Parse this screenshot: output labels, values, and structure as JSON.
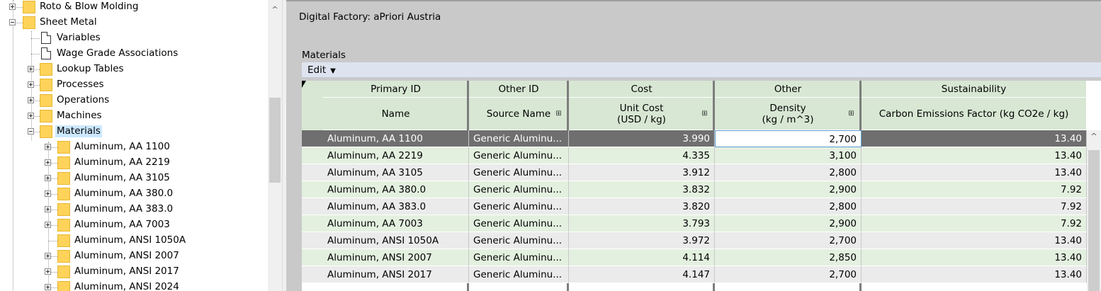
{
  "tree": {
    "nodes": [
      {
        "label": "Roto & Blow Molding",
        "level": 1,
        "kind": "folder",
        "expander": "plus"
      },
      {
        "label": "Sheet Metal",
        "level": 1,
        "kind": "folder",
        "expander": "minus"
      },
      {
        "label": "Variables",
        "level": 2,
        "kind": "doc",
        "expander": "none"
      },
      {
        "label": "Wage Grade Associations",
        "level": 2,
        "kind": "doc",
        "expander": "none"
      },
      {
        "label": "Lookup Tables",
        "level": 2,
        "kind": "folder",
        "expander": "plus"
      },
      {
        "label": "Processes",
        "level": 2,
        "kind": "folder",
        "expander": "plus"
      },
      {
        "label": "Operations",
        "level": 2,
        "kind": "folder",
        "expander": "plus"
      },
      {
        "label": "Machines",
        "level": 2,
        "kind": "folder",
        "expander": "plus"
      },
      {
        "label": "Materials",
        "level": 2,
        "kind": "folder",
        "expander": "minus",
        "selected": true
      },
      {
        "label": "Aluminum, AA 1100",
        "level": 3,
        "kind": "folder",
        "expander": "plus"
      },
      {
        "label": "Aluminum, AA 2219",
        "level": 3,
        "kind": "folder",
        "expander": "plus"
      },
      {
        "label": "Aluminum, AA 3105",
        "level": 3,
        "kind": "folder",
        "expander": "plus"
      },
      {
        "label": "Aluminum, AA 380.0",
        "level": 3,
        "kind": "folder",
        "expander": "plus"
      },
      {
        "label": "Aluminum, AA 383.0",
        "level": 3,
        "kind": "folder",
        "expander": "plus"
      },
      {
        "label": "Aluminum, AA 7003",
        "level": 3,
        "kind": "folder",
        "expander": "plus"
      },
      {
        "label": "Aluminum, ANSI 1050A",
        "level": 3,
        "kind": "folder",
        "expander": "none"
      },
      {
        "label": "Aluminum, ANSI 2007",
        "level": 3,
        "kind": "folder",
        "expander": "plus"
      },
      {
        "label": "Aluminum, ANSI 2017",
        "level": 3,
        "kind": "folder",
        "expander": "plus"
      },
      {
        "label": "Aluminum, ANSI 2024",
        "level": 3,
        "kind": "folder",
        "expander": "plus"
      }
    ],
    "scroll_up_glyph": "^"
  },
  "main": {
    "digital_factory": "Digital Factory:  aPriori Austria",
    "materials_label": "Materials",
    "edit_label": "Edit",
    "edit_caret": "▼"
  },
  "grid": {
    "groups": [
      {
        "label": "Primary ID",
        "key": "name"
      },
      {
        "label": "Other ID",
        "key": "source"
      },
      {
        "label": "Cost",
        "key": "cost"
      },
      {
        "label": "Other",
        "key": "density"
      },
      {
        "label": "Sustainability",
        "key": "carbon"
      }
    ],
    "columns": [
      {
        "key": "name",
        "label": "Name",
        "filter": false,
        "align": "left"
      },
      {
        "key": "source",
        "label": "Source Name",
        "filter": true,
        "align": "left"
      },
      {
        "key": "cost",
        "label": "Unit Cost\n(USD / kg)",
        "filter": true,
        "align": "right"
      },
      {
        "key": "density",
        "label": "Density\n(kg / m^3)",
        "filter": true,
        "align": "right"
      },
      {
        "key": "carbon",
        "label": "Carbon Emissions Factor (kg CO2e / kg)",
        "filter": false,
        "align": "right"
      }
    ],
    "filter_glyph": "⊞",
    "rows": [
      {
        "name": "Aluminum, AA 1100",
        "source": "Generic Aluminu...",
        "cost": "3.990",
        "density": "2,700",
        "carbon": "13.40",
        "selected": true
      },
      {
        "name": "Aluminum, AA 2219",
        "source": "Generic Aluminu...",
        "cost": "4.335",
        "density": "3,100",
        "carbon": "13.40"
      },
      {
        "name": "Aluminum, AA 3105",
        "source": "Generic Aluminu...",
        "cost": "3.912",
        "density": "2,800",
        "carbon": "13.40"
      },
      {
        "name": "Aluminum, AA 380.0",
        "source": "Generic Aluminu...",
        "cost": "3.832",
        "density": "2,900",
        "carbon": "7.92"
      },
      {
        "name": "Aluminum, AA 383.0",
        "source": "Generic Aluminu...",
        "cost": "3.820",
        "density": "2,800",
        "carbon": "7.92"
      },
      {
        "name": "Aluminum, AA 7003",
        "source": "Generic Aluminu...",
        "cost": "3.793",
        "density": "2,900",
        "carbon": "7.92"
      },
      {
        "name": "Aluminum, ANSI 1050A",
        "source": "Generic Aluminu...",
        "cost": "3.972",
        "density": "2,700",
        "carbon": "13.40"
      },
      {
        "name": "Aluminum, ANSI 2007",
        "source": "Generic Aluminu...",
        "cost": "4.114",
        "density": "2,850",
        "carbon": "13.40"
      },
      {
        "name": "Aluminum, ANSI 2017",
        "source": "Generic Aluminu...",
        "cost": "4.147",
        "density": "2,700",
        "carbon": "13.40"
      }
    ],
    "scroll_up_glyph": "^"
  },
  "colors": {
    "header_green": "#d7e7d3",
    "row_green": "#e3f0df",
    "row_gray": "#ebebeb",
    "selected_row": "#6f6f6f",
    "active_cell_border": "#5b9bd5",
    "tree_selection": "#cce8ff",
    "folder_yellow": "#ffd35a"
  }
}
